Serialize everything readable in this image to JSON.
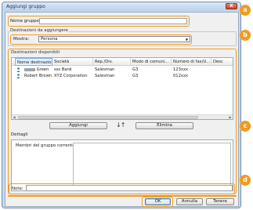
{
  "window": {
    "title": "Aggiungi gruppo",
    "close_label": "X"
  },
  "group_name": {
    "label": "Nome gruppo:",
    "value": ""
  },
  "destinations_to_add": {
    "title": "Destinazioni da aggiungere",
    "show_label": "Mostra:",
    "show_value": "Persona"
  },
  "available": {
    "title": "Destinazioni disponibili",
    "columns": [
      "Nome destinazio...",
      "Società",
      "Rep./Div.",
      "Modo di comuni...",
      "Numero di fax/U...",
      "Desc"
    ],
    "rows": [
      {
        "name": "Green",
        "company": "sss Bank",
        "dept": "Salesman",
        "mode": "G3",
        "number": "123xxx"
      },
      {
        "name": "Robert Brown",
        "company": "XYZ Corporation",
        "dept": "Salesman",
        "mode": "G3",
        "number": "012xxx"
      }
    ],
    "add_label": "Aggiungi",
    "arrows": "↓↑",
    "remove_label": "Elimina"
  },
  "details": {
    "title": "Dettagli",
    "members_label": "Membri del gruppo corrente:"
  },
  "note": {
    "label": "Note:",
    "value": ""
  },
  "footer": {
    "ok_label": "OK",
    "cancel_label": "Annulla",
    "apply_label": "Tenere"
  },
  "badges": {
    "a": "a",
    "b": "b",
    "c": "c",
    "d": "d"
  },
  "colors": {
    "highlight": "#f29b1e",
    "title_bar": "#c7d9ee",
    "close_button": "#c8442b"
  }
}
